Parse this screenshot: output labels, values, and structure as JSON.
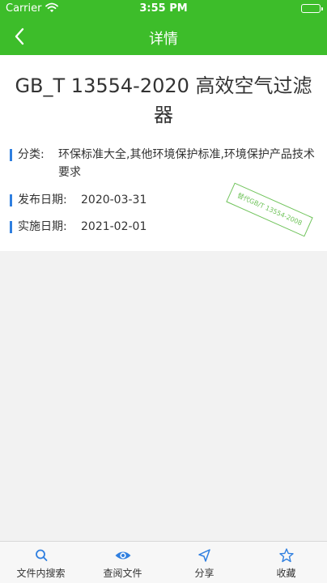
{
  "status_bar": {
    "carrier": "Carrier",
    "time": "3:55 PM",
    "wifi_icon": "wifi-icon",
    "battery_icon": "battery-icon"
  },
  "nav": {
    "title": "详情",
    "back_icon": "chevron-left-icon",
    "color": "#3dbd2a"
  },
  "document": {
    "title": "GB_T 13554-2020 高效空气过滤器",
    "classification_label": "分类:",
    "classification_value": "环保标准大全,其他环境保护标准,环境保护产品技术要求",
    "publish_label": "发布日期:",
    "publish_date": "2020-03-31",
    "implement_label": "实施日期:",
    "implement_date": "2021-02-01",
    "stamp_text": "替代GB/T 13554-2008",
    "accent_color": "#2f7fe0"
  },
  "tab_bar": {
    "items": [
      {
        "label": "文件内搜索",
        "icon": "search-icon"
      },
      {
        "label": "查阅文件",
        "icon": "eye-icon"
      },
      {
        "label": "分享",
        "icon": "send-icon"
      },
      {
        "label": "收藏",
        "icon": "star-icon"
      }
    ]
  }
}
